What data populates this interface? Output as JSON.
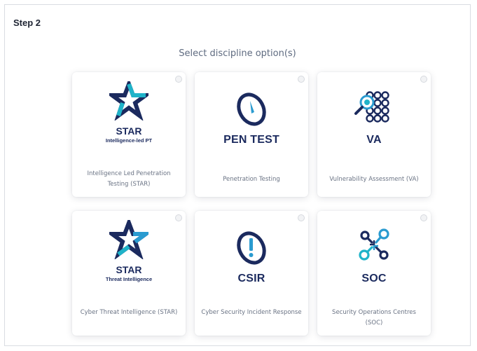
{
  "step_title": "Step 2",
  "subtitle": "Select discipline option(s)",
  "colors": {
    "navy": "#1b2a5e",
    "teal": "#1fb3c9",
    "accent": "#2a9bd0"
  },
  "cards": [
    {
      "logo_title": "STAR",
      "logo_sub": "Intelligence-led PT",
      "caption": "Intelligence Led Penetration Testing (STAR)",
      "icon": "star-icon",
      "selected": false
    },
    {
      "logo_title": "PEN TEST",
      "logo_sub": "",
      "caption": "Penetration Testing",
      "icon": "pen-test-icon",
      "selected": false
    },
    {
      "logo_title": "VA",
      "logo_sub": "",
      "caption": "Vulnerability Assessment (VA)",
      "icon": "va-icon",
      "selected": false
    },
    {
      "logo_title": "STAR",
      "logo_sub": "Threat Intelligence",
      "caption": "Cyber Threat Intelligence (STAR)",
      "icon": "star-icon",
      "selected": false
    },
    {
      "logo_title": "CSIR",
      "logo_sub": "",
      "caption": "Cyber Security Incident Response",
      "icon": "csir-icon",
      "selected": false
    },
    {
      "logo_title": "SOC",
      "logo_sub": "",
      "caption": "Security Operations Centres (SOC)",
      "icon": "soc-icon",
      "selected": false
    }
  ]
}
